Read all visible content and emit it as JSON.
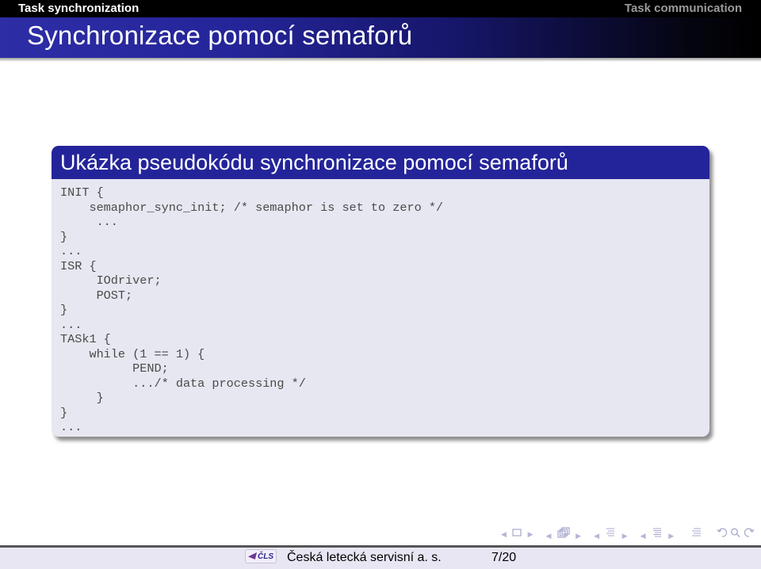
{
  "headline": {
    "section_left": "Task synchronization",
    "section_right": "Task communication"
  },
  "frame": {
    "title": "Synchronizace pomocí semaforů"
  },
  "block": {
    "title": "Ukázka pseudokódu synchronizace pomocí semaforů",
    "code_lines": [
      "INIT {",
      "    semaphor_sync_init; /* semaphor is set to zero */",
      "     ...",
      "}",
      "...",
      "ISR {",
      "     IOdriver;",
      "     POST;",
      "}",
      "...",
      "TASk1 {",
      "    while (1 == 1) {",
      "          PEND;",
      "          .../* data processing */",
      "     }",
      "}",
      "..."
    ]
  },
  "navigation": {
    "icons": [
      "frame-icon",
      "subsection-icon",
      "section-icon",
      "document-icon",
      "align-icon",
      "back-icon",
      "search-icon",
      "forward-icon"
    ]
  },
  "footline": {
    "logo_text": "ČLS",
    "company": "Česká letecká servisní a. s.",
    "page": "7/20"
  },
  "colors": {
    "block_title_bg": "#24249a",
    "block_body_bg": "#e7e7f1",
    "headline_bg": "#000000",
    "footline_bg": "#e9e6f3"
  }
}
